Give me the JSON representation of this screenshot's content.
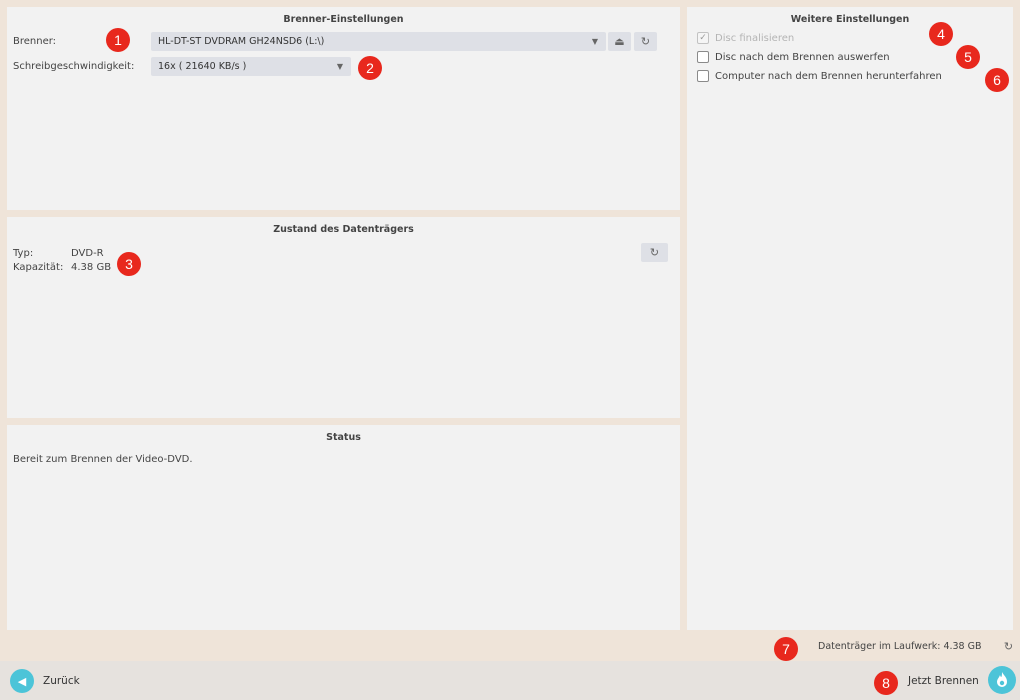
{
  "burner_settings": {
    "title": "Brenner-Einstellungen",
    "burner_label": "Brenner:",
    "burner_value": "HL-DT-ST DVDRAM GH24NSD6 (L:\\)",
    "speed_label": "Schreibgeschwindigkeit:",
    "speed_value": "16x ( 21640 KB/s )",
    "eject_icon": "eject-icon",
    "refresh_icon": "refresh-icon"
  },
  "disc_state": {
    "title": "Zustand des Datenträgers",
    "type_label": "Typ:",
    "type_value": "DVD-R",
    "capacity_label": "Kapazität:",
    "capacity_value": "4.38 GB",
    "refresh_icon": "refresh-icon"
  },
  "status": {
    "title": "Status",
    "message": "Bereit zum Brennen der Video-DVD."
  },
  "more_settings": {
    "title": "Weitere Einstellungen",
    "options": [
      {
        "label": "Disc finalisieren",
        "checked": true,
        "disabled": true
      },
      {
        "label": "Disc nach dem Brennen auswerfen",
        "checked": false,
        "disabled": false
      },
      {
        "label": "Computer nach dem Brennen herunterfahren",
        "checked": false,
        "disabled": false
      }
    ]
  },
  "drive_info": {
    "text": "Datenträger im Laufwerk: 4.38 GB"
  },
  "footer": {
    "back_label": "Zurück",
    "burn_label": "Jetzt Brennen"
  },
  "badges": [
    "1",
    "2",
    "3",
    "4",
    "5",
    "6",
    "7",
    "8"
  ],
  "colors": {
    "badge": "#e8281d",
    "accent": "#4cc4d8",
    "panel": "#f2f2f2",
    "background": "#efe4d9"
  }
}
